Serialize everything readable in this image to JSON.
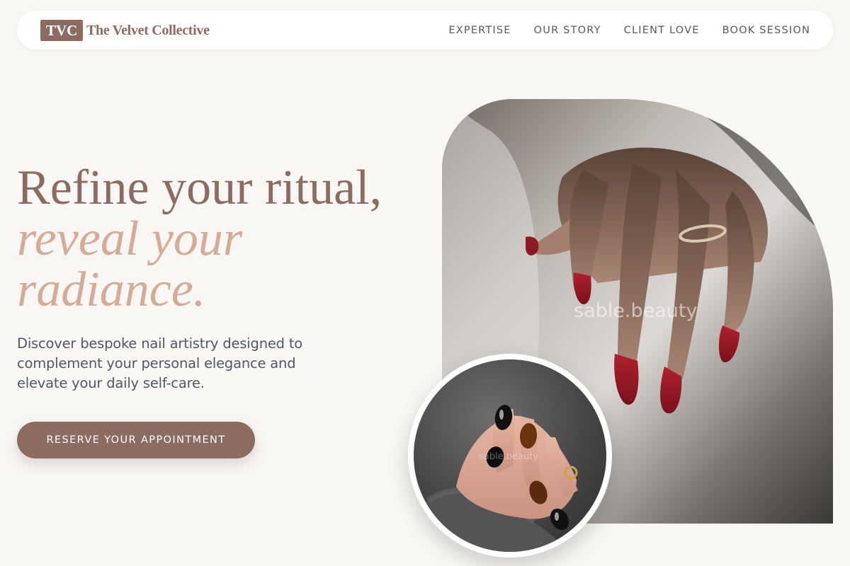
{
  "nav": {
    "logo_badge": "TVC",
    "brand_name": "The Velvet Collective",
    "links": [
      "EXPERTISE",
      "OUR STORY",
      "CLIENT LOVE",
      "BOOK SESSION"
    ]
  },
  "hero": {
    "headline_line1": "Refine your ritual,",
    "headline_line2": "reveal your",
    "headline_line3": "radiance.",
    "description": "Discover bespoke nail artistry designed to complement your personal elegance and elevate your daily self-care.",
    "cta_label": "RESERVE YOUR APPOINTMENT"
  },
  "images": {
    "main_watermark": "sable.beauty",
    "circle_watermark": "sable.beauty"
  },
  "colors": {
    "background": "#f9f7f3",
    "brand": "#8c6b60",
    "accent": "#d6ab95",
    "nail_red": "#9a1a28"
  }
}
